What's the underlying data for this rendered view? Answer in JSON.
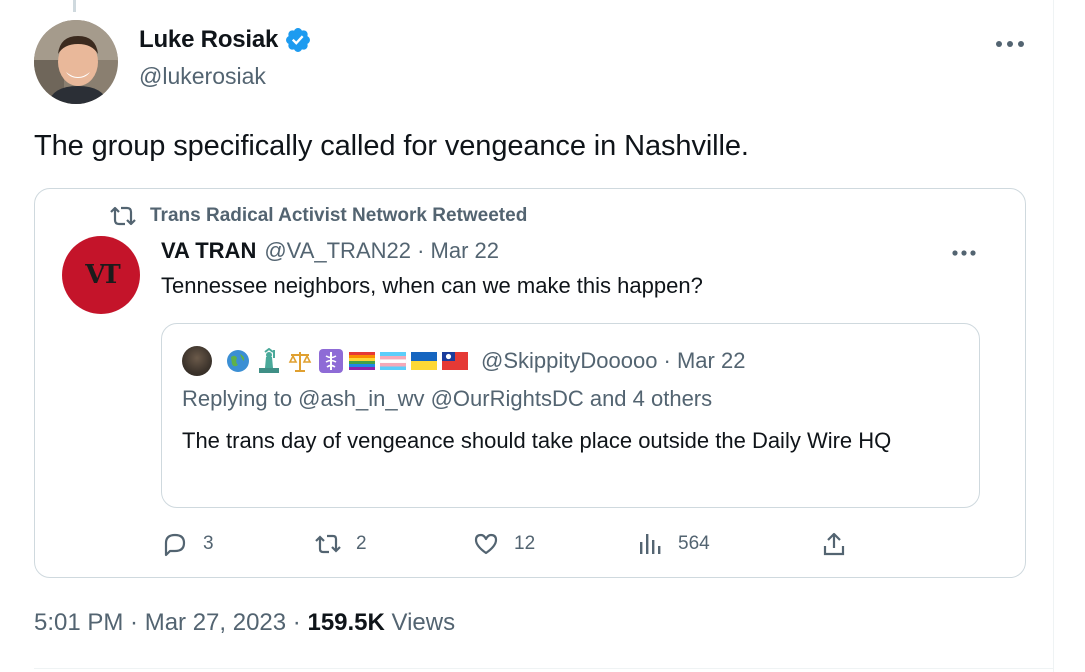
{
  "author": {
    "name": "Luke Rosiak",
    "handle": "@lukerosiak",
    "verified": true,
    "avatar_icon": "profile-photo"
  },
  "tweet": {
    "text": "The group specifically called for vengeance in Nashville."
  },
  "quoted": {
    "retweeted_by": "Trans Radical Activist Network Retweeted",
    "name": "VA TRAN",
    "meta": "@VA_TRAN22 · Mar 22",
    "avatar_text": "VT",
    "text": "Tennessee neighbors, when can we make this happen?",
    "nested": {
      "handle_meta": "@SkippityDooooo · Mar 22",
      "replying": "Replying to @ash_in_wv @OurRightsDC and 4 others",
      "text": "The trans day of vengeance should take place outside the Daily Wire HQ",
      "emoji_icons": [
        "globe-icon",
        "statue-of-liberty-icon",
        "balance-scale-icon",
        "medical-symbol-icon",
        "rainbow-flag-icon",
        "trans-flag-icon",
        "ukraine-flag-icon",
        "taiwan-flag-icon"
      ]
    },
    "actions": {
      "replies": "3",
      "retweets": "2",
      "likes": "12",
      "views": "564"
    }
  },
  "footer": {
    "time": "5:01 PM · Mar 27, 2023 · ",
    "views_count": "159.5K",
    "views_label": " Views"
  },
  "colors": {
    "text": "#0f1419",
    "muted": "#536471",
    "border": "#cfd9de",
    "verified": "#1d9bf0",
    "vt_red": "#c4142a"
  }
}
